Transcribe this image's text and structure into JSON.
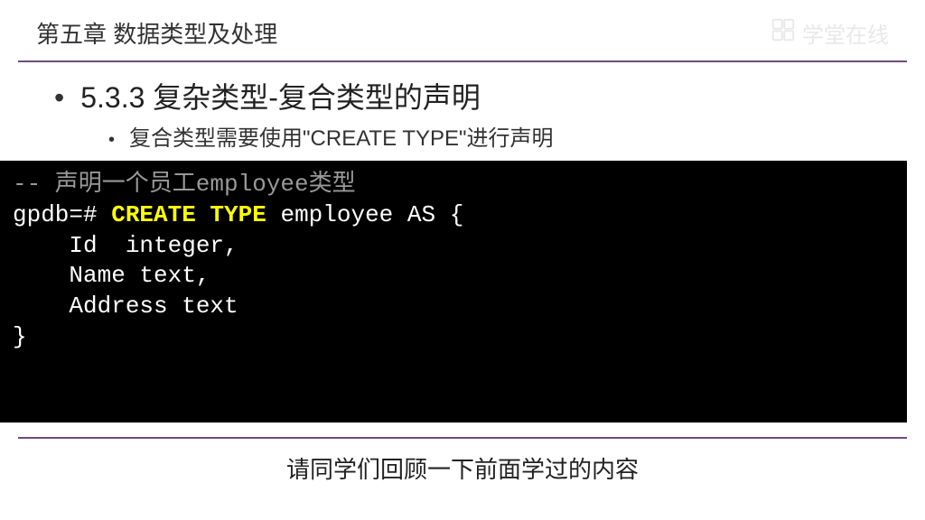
{
  "header": {
    "chapter_title": "第五章 数据类型及处理",
    "watermark_text": "学堂在线"
  },
  "section": {
    "heading": "5.3.3 复杂类型-复合类型的声明",
    "sub_point": "复合类型需要使用\"CREATE TYPE\"进行声明"
  },
  "code": {
    "comment": "-- 声明一个员工employee类型",
    "prompt": "gpdb=# ",
    "keyword": "CREATE TYPE",
    "rest_of_line": " employee AS {",
    "line3": "    Id  integer,",
    "line4": "    Name text,",
    "line5": "    Address text",
    "line6": "}"
  },
  "footer": {
    "caption": "请同学们回顾一下前面学过的内容"
  }
}
